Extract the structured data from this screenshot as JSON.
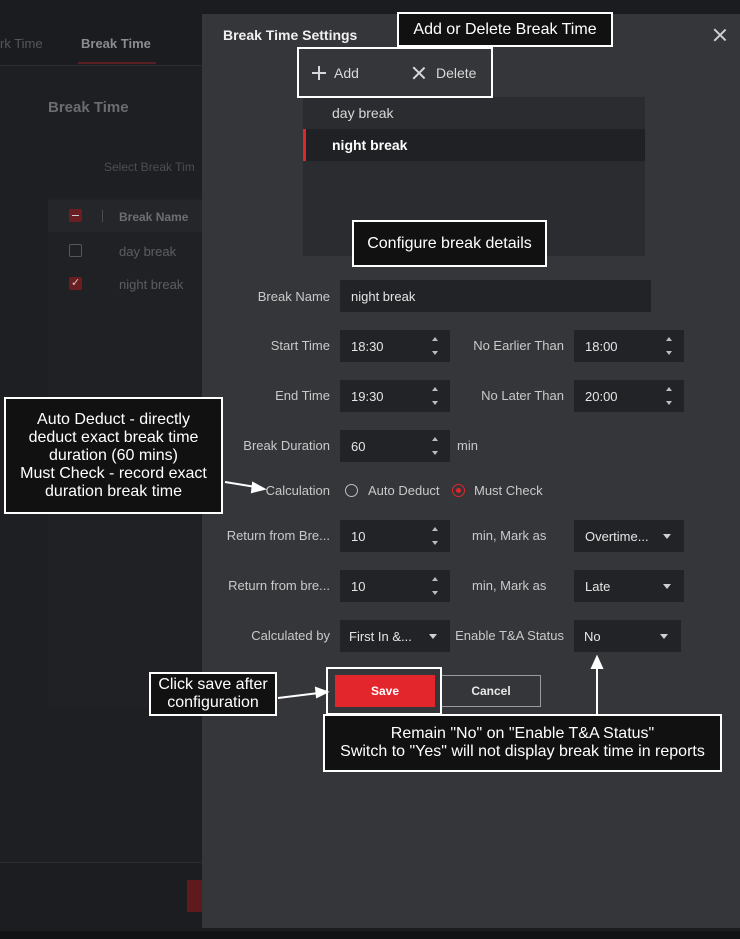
{
  "background": {
    "tabs": [
      "rk Time",
      "Break Time"
    ],
    "heading": "Break Time",
    "select_label": "Select Break Tim",
    "table_header": "Break Name",
    "rows": [
      "day break",
      "night break"
    ]
  },
  "dialog": {
    "title": "Break Time Settings",
    "toolbar": {
      "add_label": "Add",
      "delete_label": "Delete"
    },
    "break_list": [
      {
        "label": "day break",
        "selected": false
      },
      {
        "label": "night break",
        "selected": true
      }
    ],
    "form": {
      "break_name_label": "Break Name",
      "break_name_value": "night break",
      "start_time_label": "Start Time",
      "start_time_value": "18:30",
      "no_earlier_label": "No Earlier Than",
      "no_earlier_value": "18:00",
      "end_time_label": "End Time",
      "end_time_value": "19:30",
      "no_later_label": "No Later Than",
      "no_later_value": "20:00",
      "duration_label": "Break Duration",
      "duration_value": "60",
      "duration_unit": "min",
      "calculation_label": "Calculation",
      "calc_option_auto": "Auto Deduct",
      "calc_option_must": "Must Check",
      "calc_selected": "Must Check",
      "return1_label": "Return from Bre...",
      "return1_value": "10",
      "return1_mark_label": "min, Mark as",
      "return1_mark_value": "Overtime...",
      "return2_label": "Return from bre...",
      "return2_value": "10",
      "return2_mark_label": "min, Mark as",
      "return2_mark_value": "Late",
      "calculated_by_label": "Calculated by",
      "calculated_by_value": "First In &...",
      "enable_ta_label": "Enable T&A Status",
      "enable_ta_value": "No"
    },
    "buttons": {
      "save": "Save",
      "cancel": "Cancel"
    }
  },
  "annotations": {
    "add_delete": "Add or Delete Break Time",
    "configure": "Configure break details",
    "calc_note_1": "Auto Deduct - directly",
    "calc_note_2": "deduct exact break time",
    "calc_note_3": "duration (60 mins)",
    "calc_note_4": "Must Check - record exact",
    "calc_note_5": "duration break time",
    "save_note_1": "Click save after",
    "save_note_2": "configuration",
    "ta_note_1": "Remain \"No\" on \"Enable T&A Status\"",
    "ta_note_2": "Switch to \"Yes\" will not display break time in reports"
  },
  "colors": {
    "accent": "#e3252c",
    "dialog_bg": "#35363a",
    "field_bg": "#222326"
  }
}
